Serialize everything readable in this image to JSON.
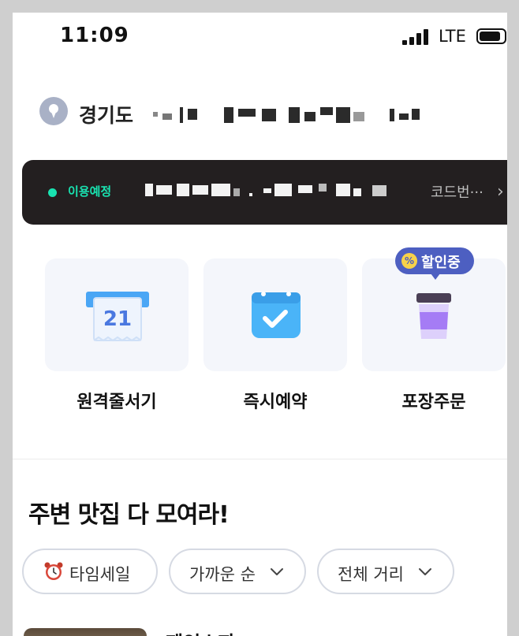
{
  "status_bar": {
    "time": "11:09",
    "network": "LTE"
  },
  "location": {
    "text": "경기도"
  },
  "reservation": {
    "status": "이용예정",
    "code_button": "코드번···",
    "chevron": "›"
  },
  "services": [
    {
      "label": "원격줄서기",
      "icon": "calendar-21-icon",
      "icon_number": "21"
    },
    {
      "label": "즉시예약",
      "icon": "calendar-check-icon"
    },
    {
      "label": "포장주문",
      "icon": "takeout-cup-icon",
      "badge": "할인중"
    }
  ],
  "section": {
    "title": "주변 맛집 다 모여라!"
  },
  "filters": [
    {
      "label": "타임세일",
      "icon": "alarm-clock-icon"
    },
    {
      "label": "가까운 순",
      "caret": "chevron-down-icon"
    },
    {
      "label": "전체 거리",
      "caret": "chevron-down-icon"
    }
  ],
  "list": {
    "first_item_title": "제인스파"
  },
  "colors": {
    "accent": "#19e3b1",
    "badge": "#4d5fc1",
    "banner": "#231f20",
    "icon_blue": "#4aa6f5",
    "cup_purple": "#a57cf5"
  }
}
